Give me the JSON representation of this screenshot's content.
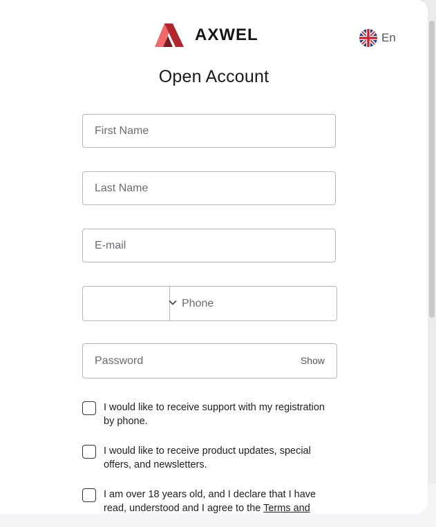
{
  "brand": {
    "name": "AXWEL"
  },
  "language": {
    "label": "En",
    "icon": "uk-flag-icon"
  },
  "form": {
    "title": "Open Account",
    "first_name_placeholder": "First Name",
    "last_name_placeholder": "Last Name",
    "email_placeholder": "E-mail",
    "country_code_value": "",
    "phone_placeholder": "Phone",
    "password_placeholder": "Password",
    "show_password_label": "Show"
  },
  "consents": [
    {
      "text": "I would like to receive support with my registration by phone.",
      "checked": false
    },
    {
      "text": "I would like to receive product updates, special offers, and newsletters.",
      "checked": false
    },
    {
      "text": "I am over 18 years old, and I declare that I have read, understood and I agree to the ",
      "link": "Terms and",
      "checked": false
    }
  ],
  "colors": {
    "logo_light": "#f06a6a",
    "logo_dark": "#b3262c",
    "border": "#b7b7bb"
  }
}
